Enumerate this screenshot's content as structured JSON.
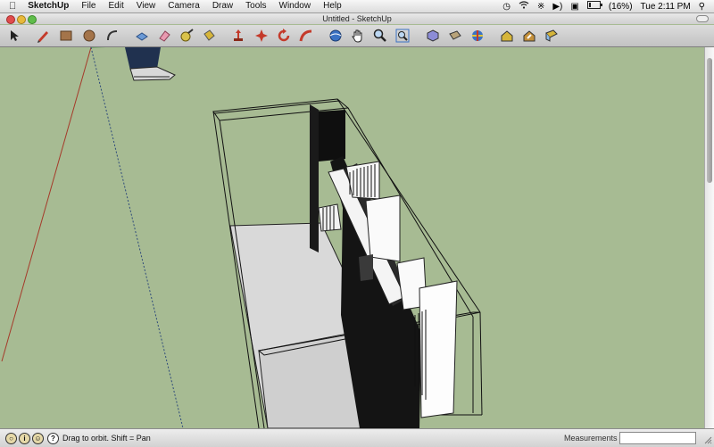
{
  "menubar": {
    "apple_icon": "apple-icon",
    "app_name": "SketchUp",
    "menus": [
      "File",
      "Edit",
      "View",
      "Camera",
      "Draw",
      "Tools",
      "Window",
      "Help"
    ],
    "status_icons": [
      "time-machine-icon",
      "wifi-icon",
      "bluetooth-icon",
      "volume-icon",
      "input-menu-icon",
      "battery-icon"
    ],
    "battery_text": "(16%)",
    "clock": "Tue 2:11 PM",
    "spotlight_icon": "magnifier-icon"
  },
  "window": {
    "title": "Untitled - SketchUp"
  },
  "toolbar": {
    "tools": [
      "select-arrow-icon",
      "pencil-icon",
      "rectangle-icon",
      "circle-icon",
      "arc-icon",
      "push-pull-icon",
      "eraser-icon",
      "tape-measure-icon",
      "paint-bucket-icon",
      "move-icon",
      "offset-icon",
      "rotate-icon",
      "follow-me-icon",
      "orbit-icon",
      "pan-hand-icon",
      "zoom-icon",
      "zoom-extents-icon",
      "iso-view-icon",
      "top-view-icon",
      "components-icon",
      "warehouse-icon",
      "share-model-icon",
      "layout-icon"
    ]
  },
  "statusbar": {
    "icons": [
      "geo-location-icon",
      "credits-icon",
      "user-icon",
      "help-icon"
    ],
    "hint": "Drag to orbit.  Shift = Pan",
    "measurements_label": "Measurements",
    "measurements_value": ""
  },
  "colors": {
    "viewport_bg": "#a7bb93",
    "ground_floor": "#d6d6d6",
    "dark_wall": "#141414",
    "axis_red": "#a53a2a",
    "axis_green": "#3c8a3c"
  }
}
